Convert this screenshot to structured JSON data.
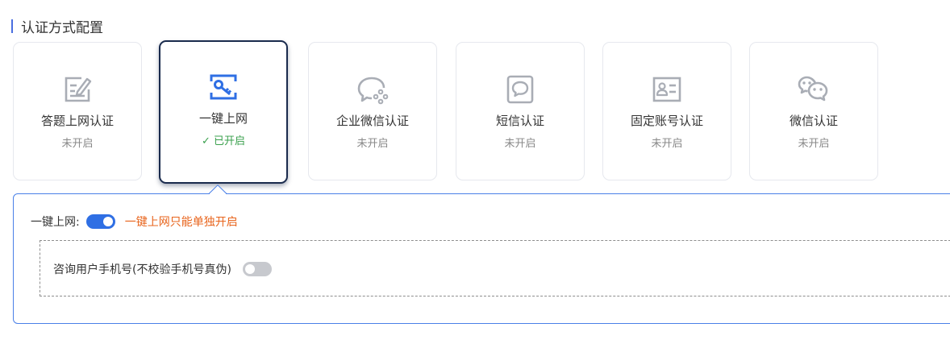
{
  "section": {
    "title": "认证方式配置",
    "accent_color": "#4a6ee0"
  },
  "auth_methods": [
    {
      "name": "答题上网认证",
      "status": "未开启",
      "icon": "quiz-edit-icon",
      "selected": false
    },
    {
      "name": "一键上网",
      "status": "✓ 已开启",
      "icon": "key-icon",
      "selected": true
    },
    {
      "name": "企业微信认证",
      "status": "未开启",
      "icon": "wecom-icon",
      "selected": false
    },
    {
      "name": "短信认证",
      "status": "未开启",
      "icon": "sms-icon",
      "selected": false
    },
    {
      "name": "固定账号认证",
      "status": "未开启",
      "icon": "id-card-icon",
      "selected": false
    },
    {
      "name": "微信认证",
      "status": "未开启",
      "icon": "wechat-icon",
      "selected": false
    }
  ],
  "detail": {
    "one_click_label": "一键上网:",
    "one_click_enabled": true,
    "one_click_hint": "一键上网只能单独开启",
    "ask_phone_label": "咨询用户手机号(不校验手机号真伪)",
    "ask_phone_enabled": false
  },
  "colors": {
    "selected_border": "#1a2b4d",
    "enabled_status": "#3aa04d",
    "disabled_status": "#888888",
    "panel_border": "#4a80e8",
    "switch_on": "#2f6fe4",
    "switch_off": "#c7c9ce",
    "hint_text": "#e8641c",
    "icon_gray": "#a9adb5",
    "icon_blue": "#2f6fe4"
  }
}
